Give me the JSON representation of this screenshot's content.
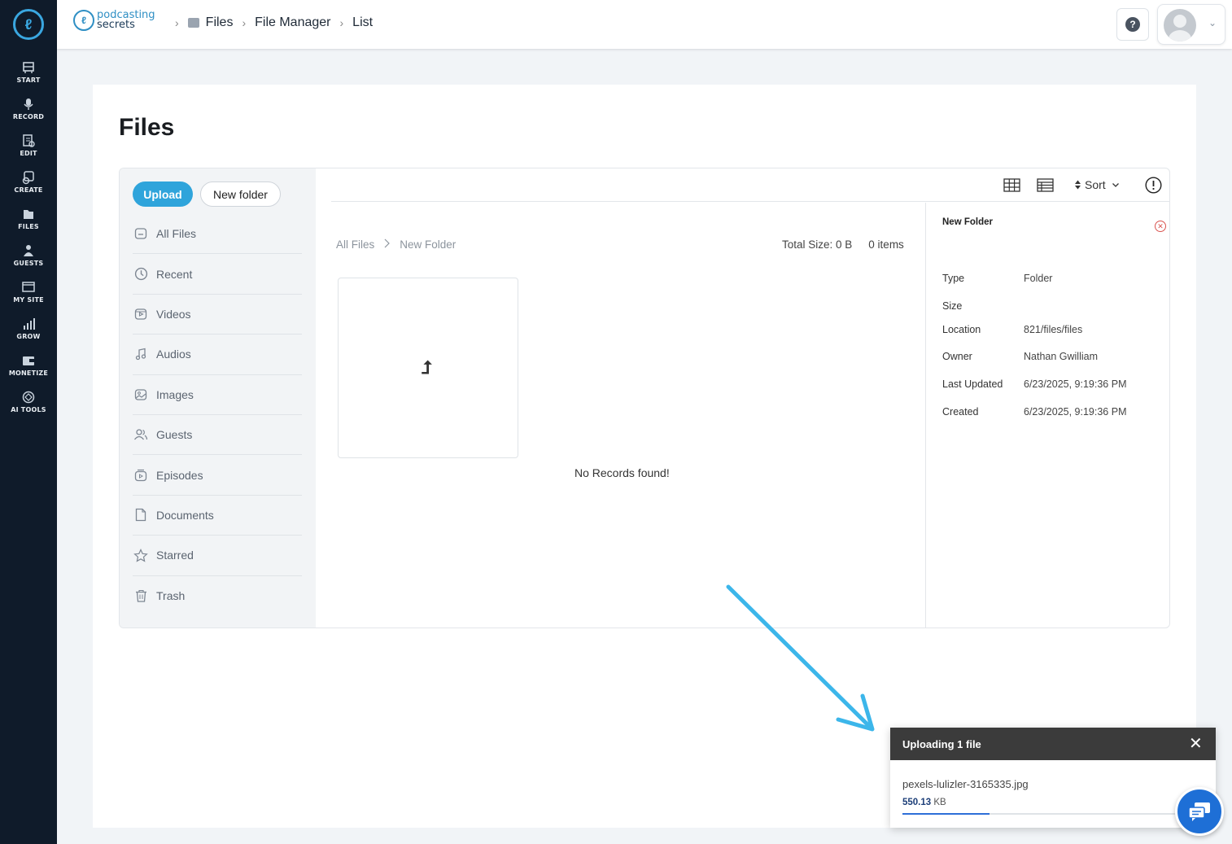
{
  "rail": {
    "items": [
      {
        "label": "START",
        "icon": "start-icon"
      },
      {
        "label": "RECORD",
        "icon": "microphone-icon"
      },
      {
        "label": "EDIT",
        "icon": "edit-icon"
      },
      {
        "label": "CREATE",
        "icon": "create-icon"
      },
      {
        "label": "FILES",
        "icon": "files-icon"
      },
      {
        "label": "GUESTS",
        "icon": "guests-icon"
      },
      {
        "label": "MY SITE",
        "icon": "site-icon"
      },
      {
        "label": "GROW",
        "icon": "chart-icon"
      },
      {
        "label": "MONETIZE",
        "icon": "monetize-icon"
      },
      {
        "label": "AI TOOLS",
        "icon": "ai-tools-icon"
      }
    ]
  },
  "brand": {
    "line1": "podcasting",
    "line2": "secrets"
  },
  "breadcrumb": [
    "Files",
    "File Manager",
    "List"
  ],
  "page": {
    "title": "Files"
  },
  "actions": {
    "upload": "Upload",
    "new_folder": "New folder"
  },
  "sidebar": {
    "items": [
      {
        "label": "All Files",
        "icon": "all-files-icon"
      },
      {
        "label": "Recent",
        "icon": "clock-icon"
      },
      {
        "label": "Videos",
        "icon": "video-icon"
      },
      {
        "label": "Audios",
        "icon": "music-note-icon"
      },
      {
        "label": "Images",
        "icon": "image-icon"
      },
      {
        "label": "Guests",
        "icon": "users-icon"
      },
      {
        "label": "Episodes",
        "icon": "episodes-icon"
      },
      {
        "label": "Documents",
        "icon": "document-icon"
      },
      {
        "label": "Starred",
        "icon": "star-icon"
      },
      {
        "label": "Trash",
        "icon": "trash-icon"
      }
    ]
  },
  "toolbar": {
    "sort": "Sort"
  },
  "content": {
    "path": [
      "All Files",
      "New Folder"
    ],
    "total_size": "Total Size: 0 B",
    "item_count": "0 items",
    "empty": "No Records found!"
  },
  "details": {
    "name": "New Folder",
    "rows": [
      {
        "key": "Type",
        "value": "Folder"
      },
      {
        "key": "Size",
        "value": ""
      },
      {
        "key": "Location",
        "value": "821/files/files"
      },
      {
        "key": "Owner",
        "value": "Nathan Gwilliam"
      },
      {
        "key": "Last Updated",
        "value": "6/23/2025, 9:19:36 PM"
      },
      {
        "key": "Created",
        "value": "6/23/2025, 9:19:36 PM"
      }
    ]
  },
  "upload_toast": {
    "title": "Uploading 1 file",
    "file_name": "pexels-lulizler-3165335.jpg",
    "size_value": "550.13",
    "size_unit": "KB",
    "progress": 0.31
  },
  "colors": {
    "accent": "#2fa4db",
    "rail_bg": "#0f1b2a",
    "annotation": "#3cb6ea",
    "chat": "#1e6fd6"
  }
}
